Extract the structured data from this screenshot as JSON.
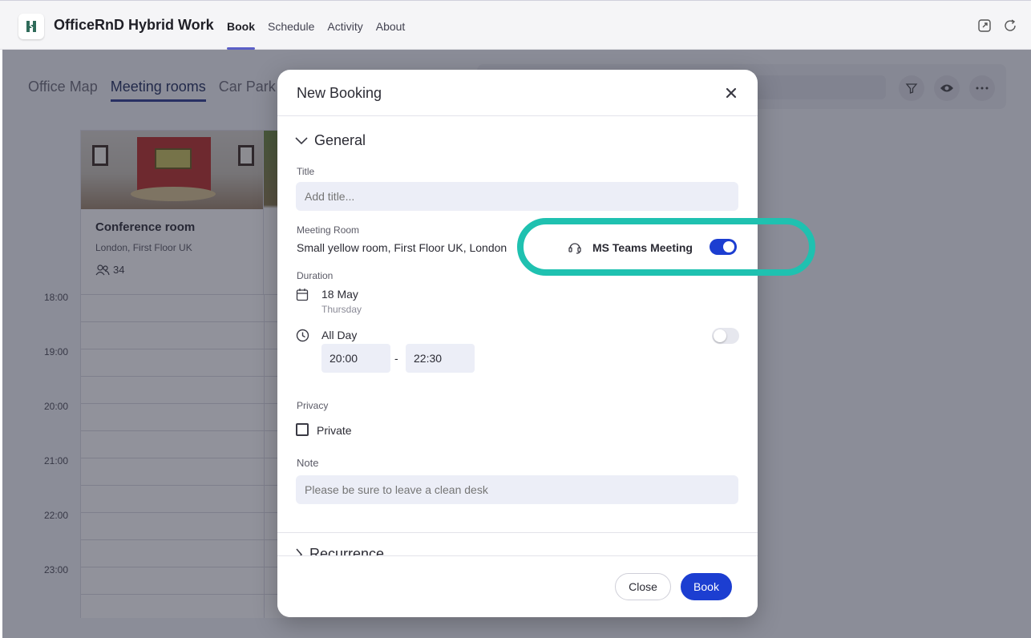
{
  "app": {
    "title": "OfficeRnD Hybrid Work",
    "nav": [
      "Book",
      "Schedule",
      "Activity",
      "About"
    ],
    "active_nav": "Book"
  },
  "background": {
    "tabs": [
      "Office Map",
      "Meeting rooms",
      "Car Park"
    ],
    "card": {
      "title": "Conference room",
      "location": "London, First Floor UK",
      "capacity": "34"
    },
    "times": [
      "18:00",
      "19:00",
      "20:00",
      "21:00",
      "22:00",
      "23:00"
    ]
  },
  "modal": {
    "title": "New Booking",
    "general_label": "General",
    "title_label": "Title",
    "title_placeholder": "Add title...",
    "meeting_room_label": "Meeting Room",
    "meeting_room_value": "Small yellow room, First Floor UK, London",
    "teams_label": "MS Teams Meeting",
    "teams_enabled": true,
    "duration_label": "Duration",
    "date": "18 May",
    "weekday": "Thursday",
    "all_day_label": "All Day",
    "all_day_enabled": false,
    "start_time": "20:00",
    "time_separator": "-",
    "end_time": "22:30",
    "privacy_label": "Privacy",
    "private_label": "Private",
    "private_checked": false,
    "note_label": "Note",
    "note_placeholder": "Please be sure to leave a clean desk",
    "recurrence_label": "Recurrence",
    "close_button": "Close",
    "book_button": "Book"
  },
  "colors": {
    "primary": "#1c3ed1",
    "highlight": "#1fc1b0",
    "nav_accent": "#5b5fc7"
  }
}
